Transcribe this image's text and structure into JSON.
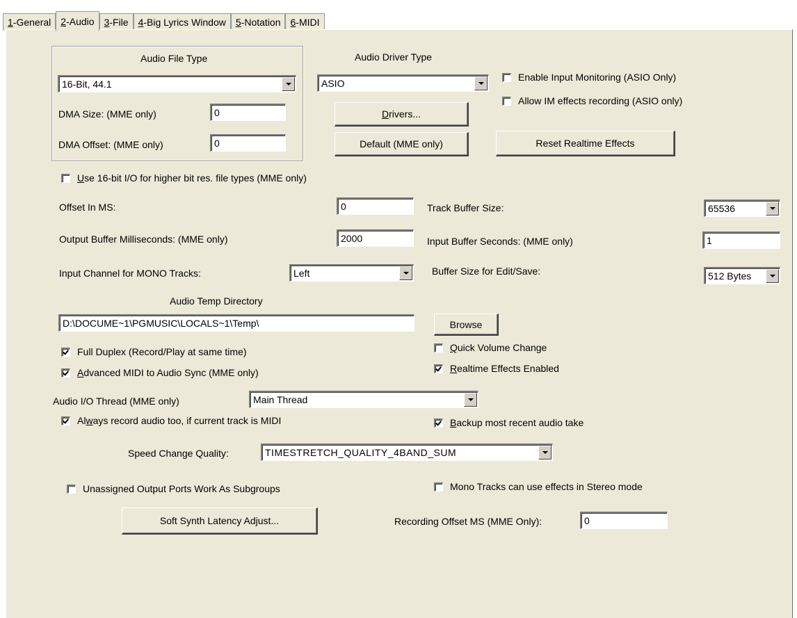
{
  "tabs": [
    {
      "key": "1",
      "rest": "-General"
    },
    {
      "key": "2",
      "rest": "-Audio"
    },
    {
      "key": "3",
      "rest": "-File"
    },
    {
      "key": "4",
      "rest": "-Big Lyrics Window"
    },
    {
      "key": "5",
      "rest": "-Notation"
    },
    {
      "key": "6",
      "rest": "-MIDI"
    }
  ],
  "audio_file_type": {
    "title": "Audio File Type",
    "selected": "16-Bit, 44.1",
    "dma_size_label": "DMA Size: (MME only)",
    "dma_size_value": "0",
    "dma_offset_label": "DMA Offset: (MME only)",
    "dma_offset_value": "0"
  },
  "audio_driver_type": {
    "title": "Audio Driver Type",
    "selected": "ASIO",
    "drivers_button_key": "D",
    "drivers_button_rest": "rivers...",
    "default_button": "Default (MME only)"
  },
  "input_monitoring": {
    "label": "Enable Input Monitoring (ASIO Only)",
    "checked": false
  },
  "allow_im_effects": {
    "label": "Allow IM effects recording (ASIO only)",
    "checked": false
  },
  "reset_realtime_button": "Reset Realtime Effects",
  "use_16bit": {
    "key": "U",
    "rest": "se 16-bit I/O for higher bit res. file types (MME only)",
    "checked": false
  },
  "offset_ms": {
    "label": "Offset In MS:",
    "value": "0"
  },
  "track_buffer": {
    "label": "Track Buffer Size:",
    "value": "65536"
  },
  "output_buffer": {
    "label": "Output Buffer Milliseconds: (MME only)",
    "value": "2000"
  },
  "input_buffer": {
    "label": "Input Buffer Seconds: (MME only)",
    "value": "1"
  },
  "input_channel": {
    "label": "Input Channel for MONO Tracks:",
    "value": "Left"
  },
  "edit_buffer": {
    "label": "Buffer Size for Edit/Save:",
    "value": "512 Bytes"
  },
  "temp_dir": {
    "label": "Audio Temp Directory",
    "value": "D:\\DOCUME~1\\PGMUSIC\\LOCALS~1\\Temp\\",
    "browse": "Browse"
  },
  "full_duplex": {
    "label": "Full Duplex (Record/Play at same time)",
    "checked": true
  },
  "quick_volume": {
    "key": "Q",
    "rest": "uick Volume Change",
    "checked": false
  },
  "adv_midi_sync": {
    "key": "A",
    "rest": "dvanced MIDI to Audio Sync (MME only)",
    "checked": true
  },
  "realtime_effects": {
    "key": "R",
    "rest": "ealtime Effects Enabled",
    "checked": true
  },
  "io_thread": {
    "label": "Audio I/O Thread (MME only)",
    "value": "Main Thread"
  },
  "always_record": {
    "pre": "Al",
    "key": "w",
    "rest": "ays record audio too, if current track is MIDI",
    "checked": true
  },
  "backup_take": {
    "key": "B",
    "rest": "ackup most recent audio take",
    "checked": true
  },
  "speed_quality": {
    "label": "Speed Change Quality:",
    "value": "TIMESTRETCH_QUALITY_4BAND_SUM"
  },
  "unassigned_ports": {
    "label": "Unassigned Output Ports Work As Subgroups",
    "checked": false
  },
  "mono_stereo": {
    "label": "Mono Tracks can use effects in Stereo mode",
    "checked": false
  },
  "soft_synth_button": "Soft Synth Latency Adjust...",
  "recording_offset": {
    "label": "Recording Offset MS (MME Only):",
    "value": "0"
  }
}
